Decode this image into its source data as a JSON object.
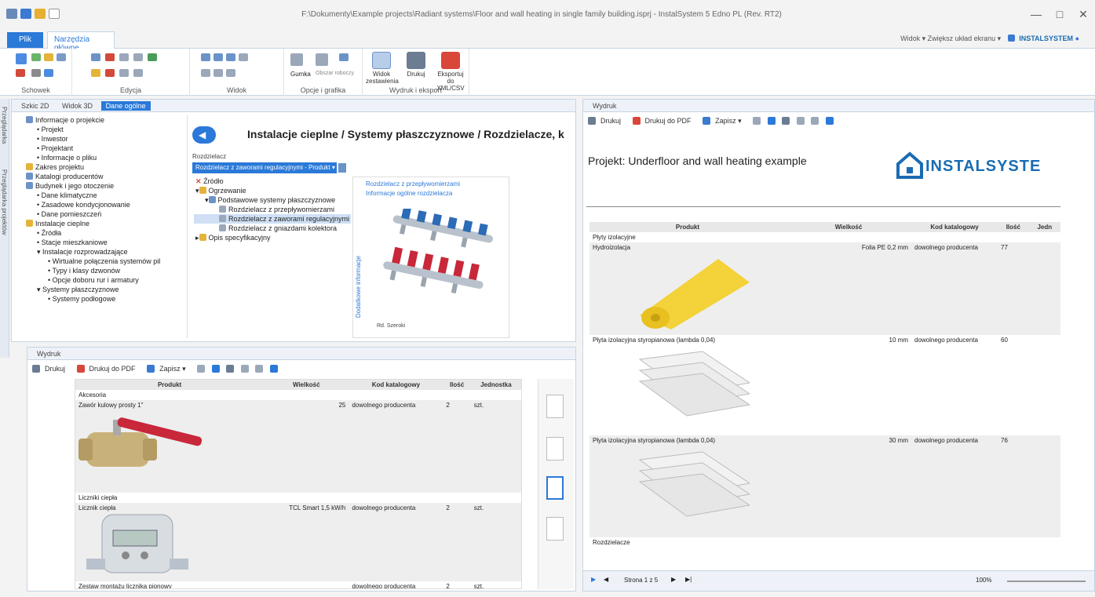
{
  "window": {
    "title": "F:\\Dokumenty\\Example projects\\Radiant systems\\Floor and wall heating in single family building.isprj - InstalSystem 5 Edno PL (Rev. RT2)",
    "minimize": "—",
    "maximize": "□",
    "close": "✕"
  },
  "tabs": {
    "file": "Plik",
    "main": "Narzędzia główne",
    "right_links": "Widok ▾   Zwiększ układ ekranu ▾",
    "brand_small": "INSTALSYSTEM"
  },
  "ribbon": {
    "groups": [
      "Schowek",
      "Edycja",
      "Widok",
      "Opcje i grafika",
      "Wydruk i eksport"
    ],
    "buttons": {
      "preview": "Widok zestawienia",
      "print": "Drukuj",
      "export": "Eksportuj do XML/CSV"
    },
    "small": {
      "rubber": "Gumka",
      "area": "Obszar roboczy"
    }
  },
  "left_panel": {
    "tabs": [
      "Szkic 2D",
      "Widok 3D",
      "Dane ogólne"
    ],
    "tree": [
      "Informacje o projekcie",
      "Projekt",
      "Inwestor",
      "Projektant",
      "Informacje o pliku",
      "Zakres projektu",
      "Katalogi producentów",
      "Budynek i jego otoczenie",
      "Dane klimatyczne",
      "Zasadowe kondycjonowanie",
      "Dane pomieszczeń",
      "Instalacje cieplne",
      "Źródła",
      "Stacje mieszkaniowe",
      "Instalacje rozprowadzające",
      "Wirtualne połączenia systemów pil",
      "Typy i klasy dzwonów",
      "Opcje doboru rur i armatury",
      "Systemy płaszczyznowe",
      "Systemy podłogowe"
    ],
    "vtabs": [
      "Przeglądarka",
      "Przeglądarka projektów"
    ]
  },
  "center": {
    "heading": "Instalacje cieplne / Systemy płaszczyznowe / Rozdzielacze, k",
    "label": "Rozdzielacz",
    "dropdown": "Rozdzielacz z zaworami regulacyjnymi - Produkt ▾",
    "tree": [
      "Źródło",
      "Ogrzewanie",
      "Podstawowe systemy płaszczyznowe",
      "Rozdzielacz z przepływomierzami",
      "Rozdzielacz z zaworami regulacyjnymi",
      "Rozdzielacz z gniazdami kolektora",
      "Opis specyfikacyjny"
    ],
    "info_links": [
      "Rozdzielacz z przepływomierzami",
      "Informacje ogólne rozdzielacza"
    ],
    "vertical_label": "Dodatkowe informacje",
    "caption": "Rd. Szeroki"
  },
  "bottom_panel": {
    "tab": "Wydruk",
    "toolbar": [
      "Drukuj",
      "Drukuj do PDF",
      "Zapisz ▾"
    ],
    "headers": [
      "Produkt",
      "Wielkość",
      "Kod katalogowy",
      "Ilość",
      "Jednostka"
    ],
    "sections": [
      {
        "group": "Akcesoria",
        "name": "Zawór kulowy prosty 1\"",
        "size": "25",
        "code": "dowolnego producenta",
        "qty": "2",
        "unit": "szt."
      },
      {
        "group": "Liczniki ciepła",
        "name": "Licznik ciepła",
        "size": "TCL Smart 1,5 kW/h",
        "code": "dowolnego producenta",
        "qty": "2",
        "unit": "szt."
      },
      {
        "group": "",
        "name": "Zestaw montażu licznika pionowy",
        "size": "",
        "code": "dowolnego producenta",
        "qty": "2",
        "unit": "szt."
      }
    ]
  },
  "right_panel": {
    "tab": "Wydruk",
    "toolbar": [
      "Drukuj",
      "Drukuj do PDF",
      "Zapisz ▾"
    ],
    "project_title": "Projekt: Underfloor and wall heating example",
    "brand": "INSTALSYSTE",
    "headers": [
      "Produkt",
      "Wielkość",
      "Kod katalogowy",
      "Ilość",
      "Jedn"
    ],
    "group1": "Płyty izolacyjne",
    "rows": [
      {
        "name": "Hydroizolacja",
        "size": "Folia PE 0,2 mm",
        "code": "dowolnego producenta",
        "qty": "77"
      },
      {
        "name": "Płyta izolacyjna styropianowa (lambda 0,04)",
        "size": "10 mm",
        "code": "dowolnego producenta",
        "qty": "60"
      },
      {
        "name": "Płyta izolacyjna styropianowa (lambda 0,04)",
        "size": "30 mm",
        "code": "dowolnego producenta",
        "qty": "76"
      }
    ],
    "group2": "Rozdzielacze",
    "pager": "Strona 1 z 5",
    "zoom": "100%"
  },
  "colors": {
    "accent": "#2b79d8",
    "brand": "#1a6cb3"
  }
}
